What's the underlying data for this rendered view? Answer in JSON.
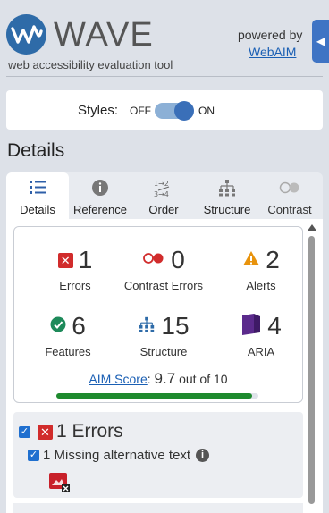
{
  "header": {
    "logo_text": "WAVE",
    "tagline": "web accessibility evaluation tool",
    "powered_by": "powered by",
    "webaim_link": "WebAIM",
    "collapse_icon": "chevron-left-icon"
  },
  "styles_toggle": {
    "label": "Styles:",
    "off_label": "OFF",
    "on_label": "ON",
    "state": "on"
  },
  "details_title": "Details",
  "tabs": [
    {
      "label": "Details",
      "icon": "list-icon",
      "active": true
    },
    {
      "label": "Reference",
      "icon": "info-icon",
      "active": false
    },
    {
      "label": "Order",
      "icon": "order-icon",
      "active": false
    },
    {
      "label": "Structure",
      "icon": "structure-icon",
      "active": false
    },
    {
      "label": "Contrast",
      "icon": "contrast-icon",
      "active": false
    }
  ],
  "summary": {
    "errors": {
      "count": "1",
      "label": "Errors"
    },
    "contrast_errors": {
      "count": "0",
      "label": "Contrast Errors"
    },
    "alerts": {
      "count": "2",
      "label": "Alerts"
    },
    "features": {
      "count": "6",
      "label": "Features"
    },
    "structure": {
      "count": "15",
      "label": "Structure"
    },
    "aria": {
      "count": "4",
      "label": "ARIA"
    }
  },
  "aim_score": {
    "link_label": "AIM Score",
    "separator": ":",
    "score": "9.7",
    "suffix": "out of 10",
    "fraction": 0.97
  },
  "errors_section": {
    "title": "1 Errors",
    "items": [
      {
        "label": "1 Missing alternative text"
      }
    ]
  },
  "colors": {
    "accent": "#3f74c4",
    "error": "#d12c2c",
    "success": "#1e8a2e",
    "alert": "#e8930c",
    "aria": "#5b2a8c"
  }
}
